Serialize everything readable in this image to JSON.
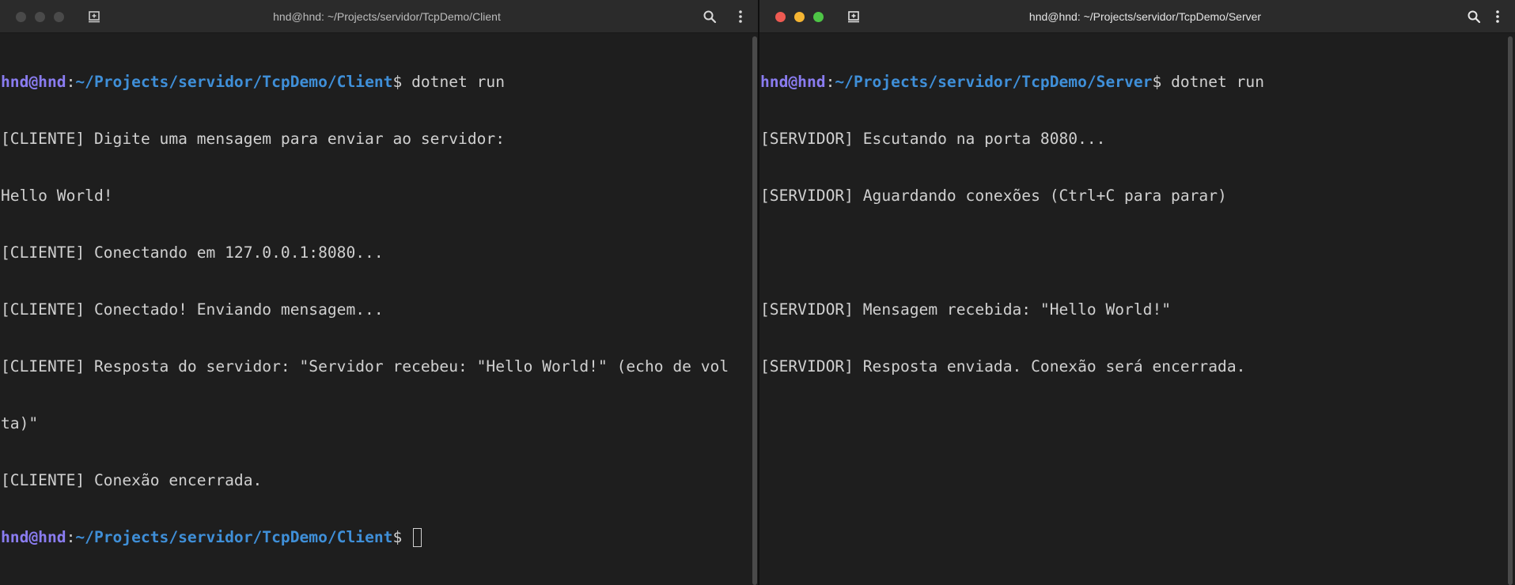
{
  "left_window": {
    "title": "hnd@hnd: ~/Projects/servidor/TcpDemo/Client",
    "prompt": {
      "user": "hnd@hnd",
      "colon": ":",
      "path": "~/Projects/servidor/TcpDemo/Client",
      "dollar": "$ "
    },
    "command": "dotnet run",
    "output": [
      "[CLIENTE] Digite uma mensagem para enviar ao servidor:",
      "Hello World!",
      "[CLIENTE] Conectando em 127.0.0.1:8080...",
      "[CLIENTE] Conectado! Enviando mensagem...",
      "[CLIENTE] Resposta do servidor: \"Servidor recebeu: \"Hello World!\" (echo de vol",
      "ta)\"",
      "[CLIENTE] Conexão encerrada."
    ],
    "focused": false
  },
  "right_window": {
    "title": "hnd@hnd: ~/Projects/servidor/TcpDemo/Server",
    "prompt": {
      "user": "hnd@hnd",
      "colon": ":",
      "path": "~/Projects/servidor/TcpDemo/Server",
      "dollar": "$ "
    },
    "command": "dotnet run",
    "output": [
      "[SERVIDOR] Escutando na porta 8080...",
      "[SERVIDOR] Aguardando conexões (Ctrl+C para parar)",
      "",
      "[SERVIDOR] Mensagem recebida: \"Hello World!\"",
      "[SERVIDOR] Resposta enviada. Conexão será encerrada."
    ],
    "focused": true
  },
  "icons": {
    "new_tab": "new-tab-icon",
    "search": "search-icon",
    "menu": "kebab-menu-icon"
  },
  "colors": {
    "background": "#1e1e1e",
    "titlebar": "#2b2b2b",
    "prompt_user": "#8a7cf0",
    "prompt_path": "#3f8fd8",
    "text": "#d0d0d0",
    "close": "#ee5a52",
    "minimize": "#f5b533",
    "maximize": "#4ec546"
  }
}
